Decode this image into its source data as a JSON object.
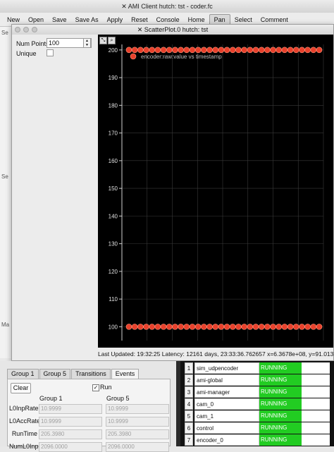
{
  "main_window": {
    "title": "AMI Client hutch: tst - coder.fc",
    "toolbar": [
      "New",
      "Open",
      "Save",
      "Save As",
      "Apply",
      "Reset",
      "Console",
      "Home",
      "Pan",
      "Select",
      "Comment"
    ],
    "active_tool": "Pan"
  },
  "scatter_window": {
    "title": "ScatterPlot.0 hutch: tst",
    "num_points_label": "Num Points",
    "num_points_value": "100",
    "unique_label": "Unique",
    "unique_checked": false,
    "status": "Last Updated: 19:32:25 Latency: 12161 days, 23:33:36.762657  x=6.3678e+08, y=91.013"
  },
  "chart_data": {
    "type": "scatter",
    "ylim": [
      95,
      202
    ],
    "yticks": [
      100,
      110,
      120,
      130,
      140,
      150,
      160,
      170,
      180,
      190,
      200
    ],
    "grid": true,
    "legend": "top-left",
    "series": [
      {
        "name": "encoder:raw:value vs timestamp",
        "color": "#e8412c",
        "upper_y": 200,
        "lower_y": 100,
        "points_per_row": 34
      }
    ]
  },
  "bottom_panel": {
    "tabs": [
      "Group 1",
      "Group 5",
      "Transitions",
      "Events"
    ],
    "selected_tab": "Events",
    "clear_label": "Clear",
    "run_label": "Run",
    "run_checked": true,
    "group1_header": "Group 1",
    "group5_header": "Group 5",
    "rows": [
      {
        "label": "L0InpRate",
        "g1": "10.9999",
        "g5": "10.9999"
      },
      {
        "label": "L0AccRate",
        "g1": "10.9999",
        "g5": "10.9999"
      },
      {
        "label": "RunTime",
        "g1": "205.3980",
        "g5": "205.3980"
      },
      {
        "label": "NumL0Inp",
        "g1": "2096.0000",
        "g5": "2096.0000"
      }
    ]
  },
  "process_table": [
    {
      "num": "1",
      "name": "sim_udpencoder",
      "status": "RUNNING"
    },
    {
      "num": "2",
      "name": "ami-global",
      "status": "RUNNING"
    },
    {
      "num": "3",
      "name": "ami-manager",
      "status": "RUNNING"
    },
    {
      "num": "4",
      "name": "cam_0",
      "status": "RUNNING"
    },
    {
      "num": "5",
      "name": "cam_1",
      "status": "RUNNING"
    },
    {
      "num": "6",
      "name": "control",
      "status": "RUNNING"
    },
    {
      "num": "7",
      "name": "encoder_0",
      "status": "RUNNING"
    }
  ]
}
